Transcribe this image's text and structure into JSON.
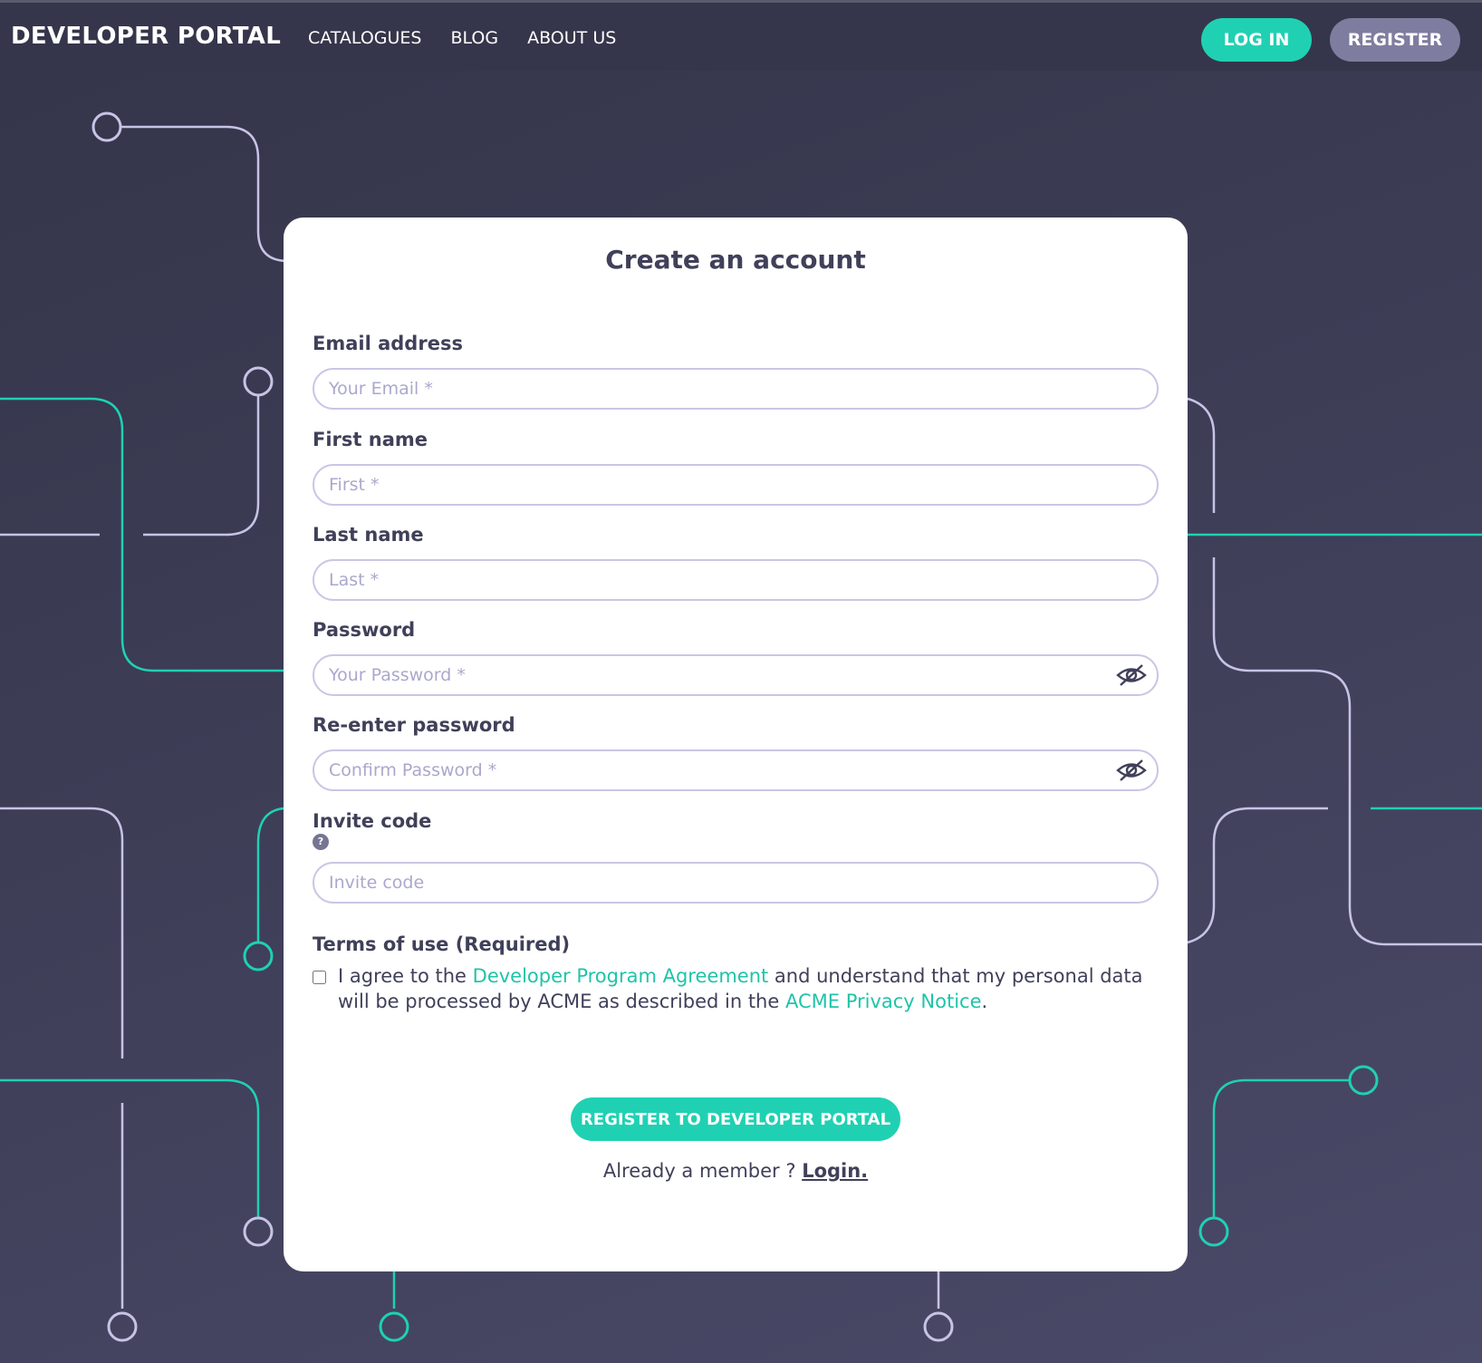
{
  "header": {
    "brand": "DEVELOPER PORTAL",
    "nav": [
      "CATALOGUES",
      "BLOG",
      "ABOUT US"
    ],
    "login_label": "LOG IN",
    "register_label": "REGISTER"
  },
  "form": {
    "title": "Create an account",
    "email": {
      "label": "Email address",
      "placeholder": "Your Email *"
    },
    "first_name": {
      "label": "First name",
      "placeholder": "First *"
    },
    "last_name": {
      "label": "Last name",
      "placeholder": "Last *"
    },
    "password": {
      "label": "Password",
      "placeholder": "Your Password *"
    },
    "confirm_password": {
      "label": "Re-enter password",
      "placeholder": "Confirm Password *"
    },
    "invite_code": {
      "label": "Invite code",
      "placeholder": "Invite code",
      "help_glyph": "?"
    },
    "terms": {
      "title": "Terms of use (Required)",
      "text_1": "I agree to the ",
      "link_1": "Developer Program Agreement",
      "text_2": " and understand that my personal data will be processed by ACME as described in the ",
      "link_2": "ACME Privacy Notice",
      "text_3": "."
    },
    "submit_label": "REGISTER TO DEVELOPER PORTAL",
    "member_text": "Already a member ? ",
    "member_link": "Login."
  },
  "colors": {
    "accent": "#1fd1b2",
    "secondary_button": "#7e7d9f",
    "background": "#3d3d56",
    "text": "#40405a"
  }
}
